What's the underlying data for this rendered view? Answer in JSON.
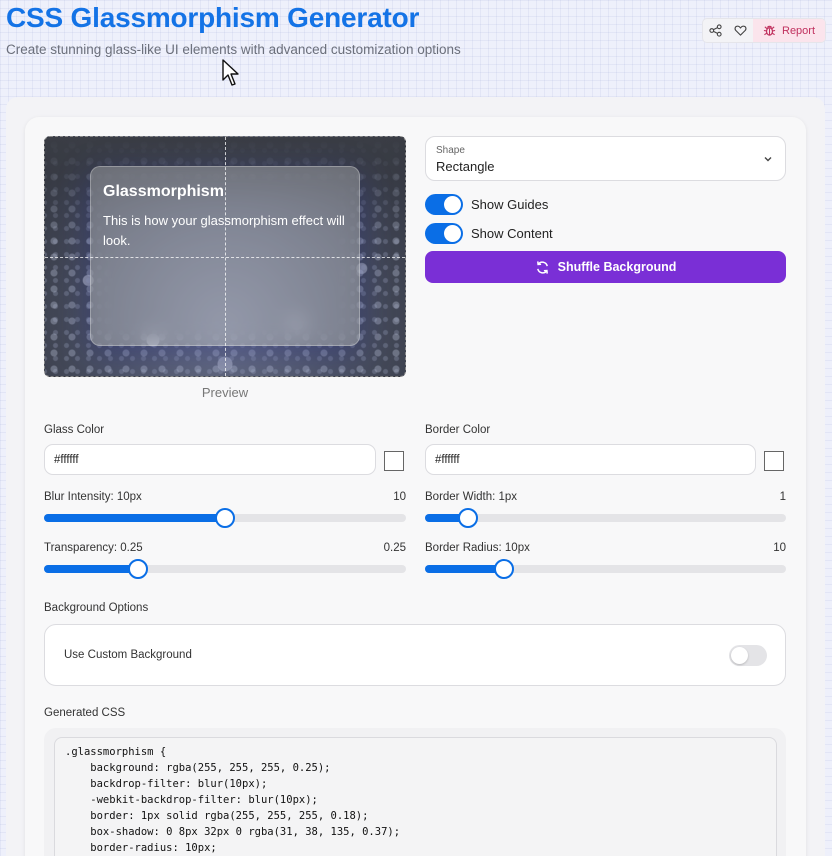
{
  "header": {
    "title": "CSS Glassmorphism Generator",
    "subtitle": "Create stunning glass-like UI elements with advanced customization options",
    "report_label": "Report"
  },
  "preview": {
    "glass_title": "Glassmorphism",
    "glass_text": "This is how your glassmorphism effect will look.",
    "label": "Preview"
  },
  "shape": {
    "label": "Shape",
    "value": "Rectangle"
  },
  "toggles": {
    "show_guides": {
      "label": "Show Guides",
      "on": true
    },
    "show_content": {
      "label": "Show Content",
      "on": true
    }
  },
  "shuffle_label": "Shuffle Background",
  "glass_color": {
    "label": "Glass Color",
    "value": "#ffffff"
  },
  "border_color": {
    "label": "Border Color",
    "value": "#ffffff"
  },
  "sliders": {
    "blur": {
      "label": "Blur Intensity: 10px",
      "value_text": "10",
      "fraction": 0.5
    },
    "border_width": {
      "label": "Border Width: 1px",
      "value_text": "1",
      "fraction": 0.12
    },
    "transparency": {
      "label": "Transparency: 0.25",
      "value_text": "0.25",
      "fraction": 0.26
    },
    "border_radius": {
      "label": "Border Radius: 10px",
      "value_text": "10",
      "fraction": 0.22
    }
  },
  "background_options": {
    "label": "Background Options",
    "custom_label": "Use Custom Background",
    "custom_on": false
  },
  "generated_css": {
    "label": "Generated CSS",
    "code": ".glassmorphism {\n    background: rgba(255, 255, 255, 0.25);\n    backdrop-filter: blur(10px);\n    -webkit-backdrop-filter: blur(10px);\n    border: 1px solid rgba(255, 255, 255, 0.18);\n    box-shadow: 0 8px 32px 0 rgba(31, 38, 135, 0.37);\n    border-radius: 10px;"
  },
  "colors": {
    "accent": "#1473e6",
    "slider": "#0a6ee6",
    "shuffle": "#7a2fd6",
    "report_bg": "#fbe4ec"
  }
}
